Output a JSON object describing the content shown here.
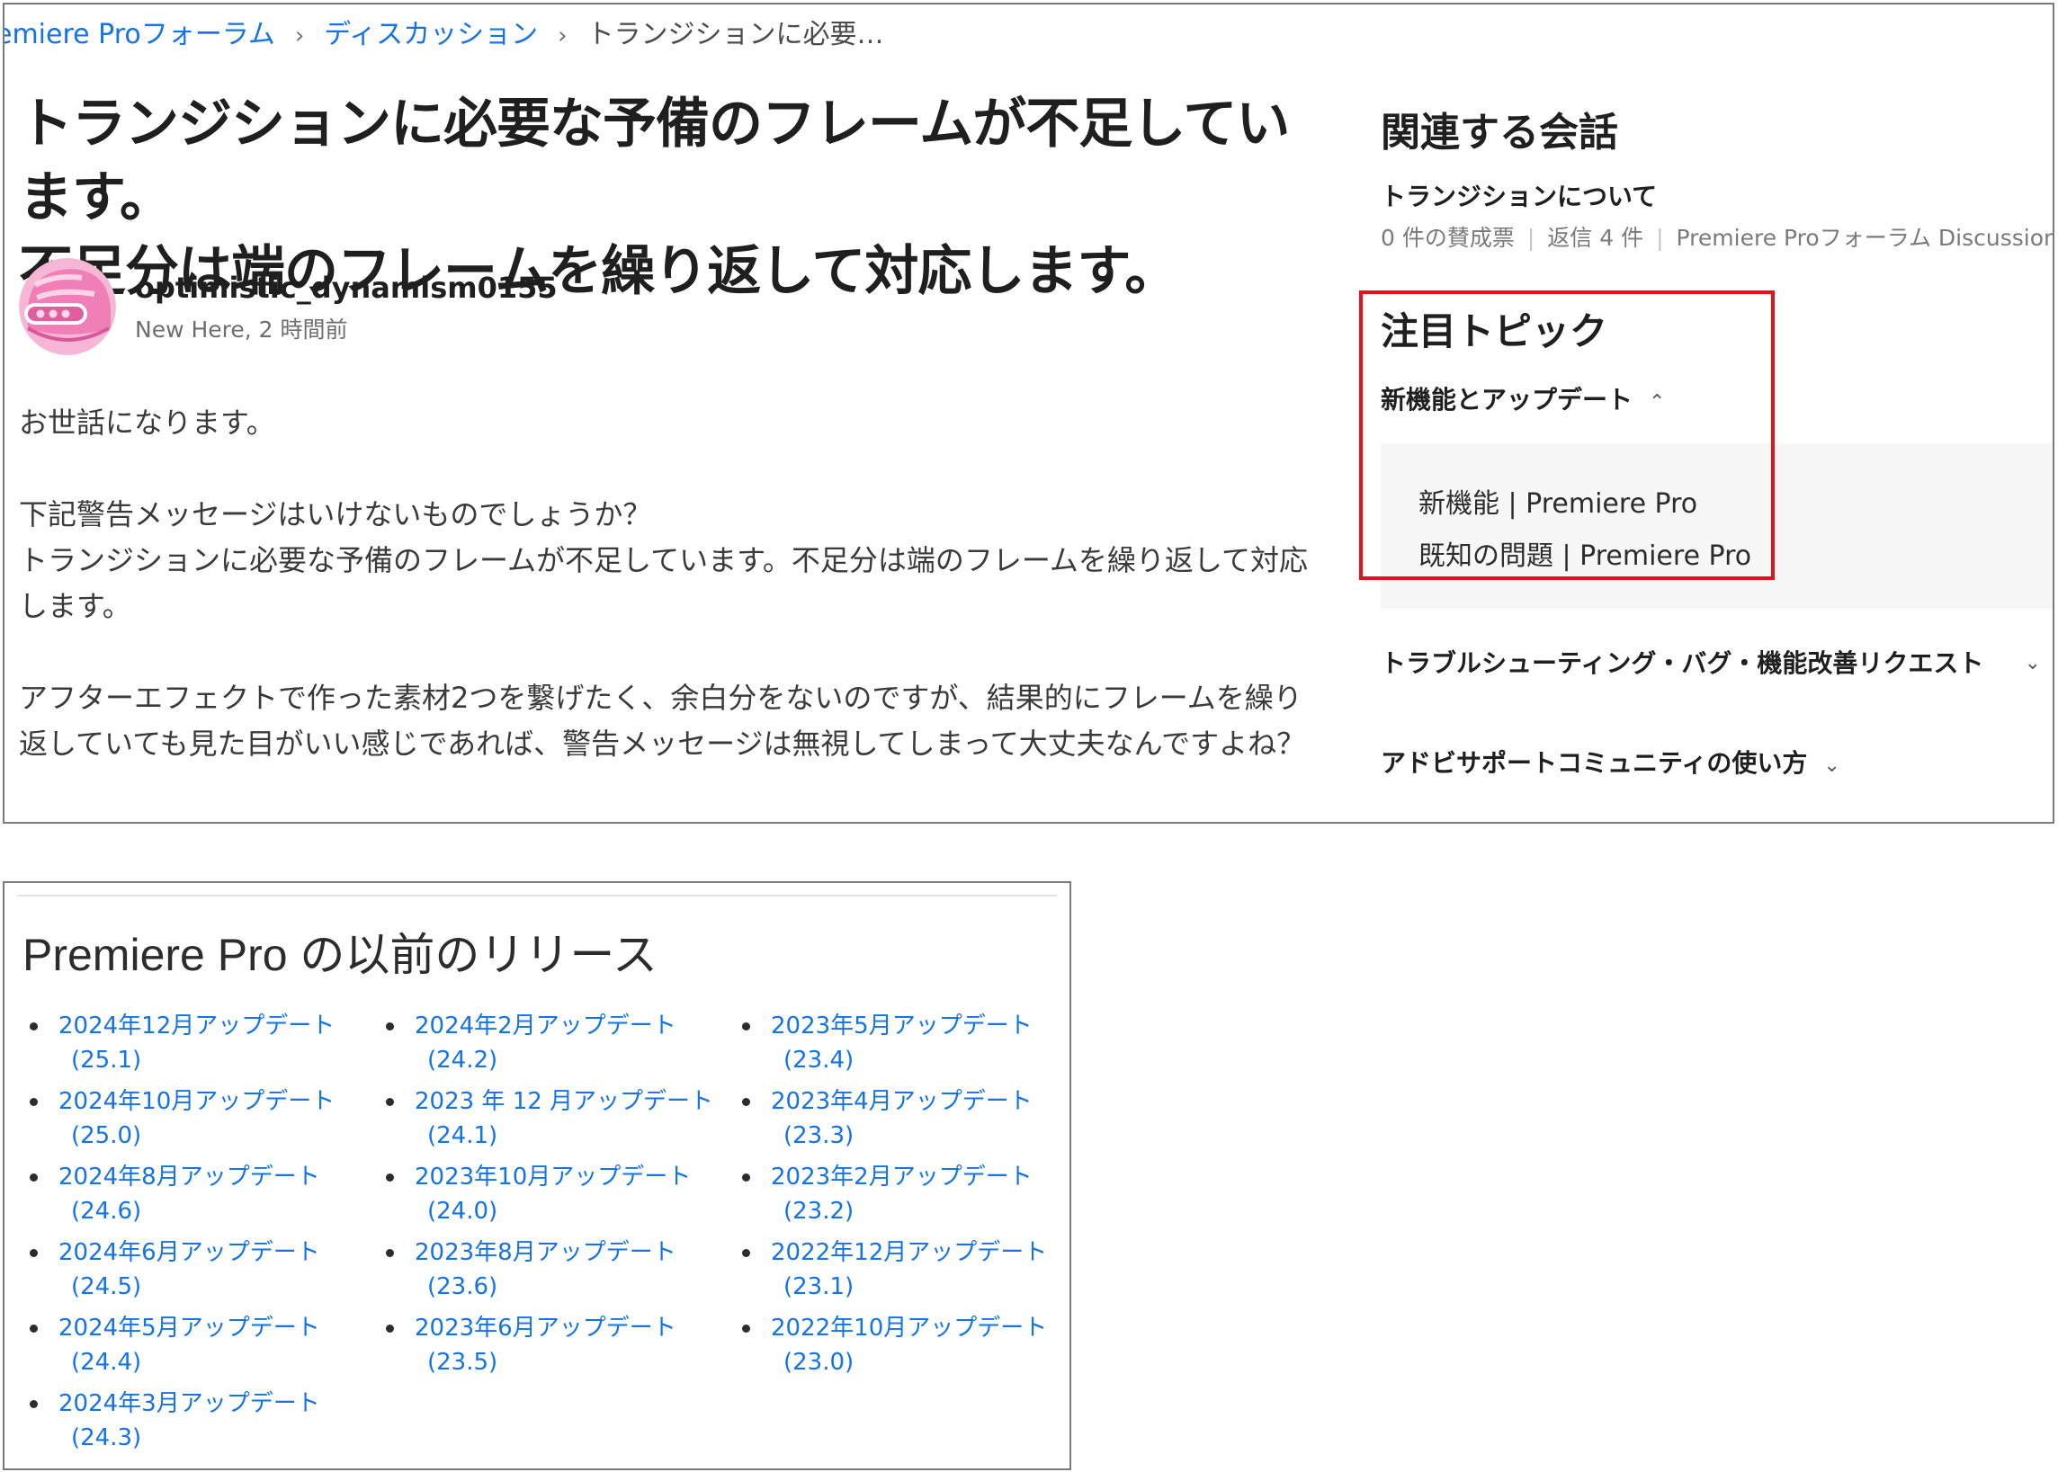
{
  "breadcrumb": {
    "forum": "emiere Proフォーラム",
    "discussions": "ディスカッション",
    "current": "トランジションに必要…",
    "separator": "›"
  },
  "post": {
    "title_line1": "トランジションに必要な予備のフレームが不足しています。",
    "title_line2": "不足分は端のフレームを繰り返して対応します。",
    "author": "optimistic_dynamism0155",
    "author_meta": "New Here, 2 時間前",
    "paragraphs": [
      "お世話になります。",
      "下記警告メッセージはいけないものでしょうか？\nトランジションに必要な予備のフレームが不足しています。不足分は端のフレームを繰り返して対応します。",
      "アフターエフェクトで作った素材2つを繋げたく、余白分をないのですが、結果的にフレームを繰り返していても見た目がいい感じであれば、警告メッセージは無視してしまって大丈夫なんですよね？"
    ]
  },
  "sidebar": {
    "related_heading": "関連する会話",
    "related_item": {
      "title": "トランジションについて",
      "votes": "0 件の賛成票",
      "replies": "返信 4 件",
      "board": "Premiere Proフォーラム Discussions"
    },
    "featured_heading": "注目トピック",
    "accordions": [
      {
        "label": "新機能とアップデート",
        "state": "expanded",
        "chevron": "⌃"
      },
      {
        "label": "トラブルシューティング・バグ・機能改善リクエスト",
        "state": "collapsed",
        "chevron": "⌄"
      },
      {
        "label": "アドビサポートコミュニティの使い方",
        "state": "collapsed",
        "chevron": "⌄"
      }
    ],
    "sub_links": [
      "新機能 | Premiere Pro",
      "既知の問題 | Premiere Pro"
    ]
  },
  "releases": {
    "heading": "Premiere Pro の以前のリリース",
    "columns": [
      [
        {
          "label": "2024年12月アップデート",
          "version": "(25.1)"
        },
        {
          "label": "2024年10月アップデート",
          "version": "(25.0)"
        },
        {
          "label": "2024年8月アップデート",
          "version": "(24.6)"
        },
        {
          "label": "2024年6月アップデート",
          "version": "(24.5)"
        },
        {
          "label": "2024年5月アップデート",
          "version": "(24.4)"
        },
        {
          "label": "2024年3月アップデート",
          "version": "(24.3)"
        }
      ],
      [
        {
          "label": "2024年2月アップデート",
          "version": "(24.2)"
        },
        {
          "label": "2023 年 12 月アップデート",
          "version": "(24.1)"
        },
        {
          "label": "2023年10月アップデート",
          "version": "(24.0)"
        },
        {
          "label": "2023年8月アップデート",
          "version": "(23.6)"
        },
        {
          "label": "2023年6月アップデート",
          "version": "(23.5)"
        }
      ],
      [
        {
          "label": "2023年5月アップデート",
          "version": "(23.4)"
        },
        {
          "label": "2023年4月アップデート",
          "version": "(23.3)"
        },
        {
          "label": "2023年2月アップデート",
          "version": "(23.2)"
        },
        {
          "label": "2022年12月アップデート",
          "version": "(23.1)"
        },
        {
          "label": "2022年10月アップデート",
          "version": "(23.0)"
        }
      ]
    ]
  },
  "colors": {
    "link": "#1473e6",
    "highlight_box": "#e3121b",
    "text": "#1f1f1f"
  },
  "icons": {
    "avatar": "pink-helmet-avatar-icon",
    "expand": "chevron-up-icon",
    "collapse": "chevron-down-icon"
  }
}
